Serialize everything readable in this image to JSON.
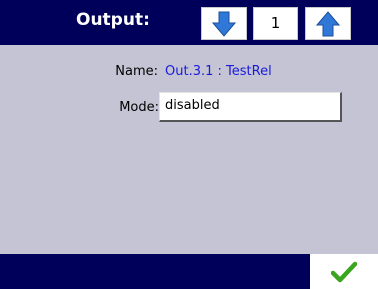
{
  "header": {
    "title": "Output:",
    "counter_value": "1",
    "down_icon": "arrow-down-icon",
    "up_icon": "arrow-up-icon"
  },
  "form": {
    "name_label": "Name:",
    "name_value": "Out.3.1 : TestRel",
    "mode_label": "Mode:",
    "mode_value": "disabled"
  },
  "footer": {
    "ok_icon": "checkmark-icon"
  },
  "colors": {
    "header_bg": "#00005a",
    "panel_bg": "#c4c4d4",
    "arrow": "#2f78d8",
    "name_value": "#1a1adc",
    "check": "#3aa51e"
  }
}
